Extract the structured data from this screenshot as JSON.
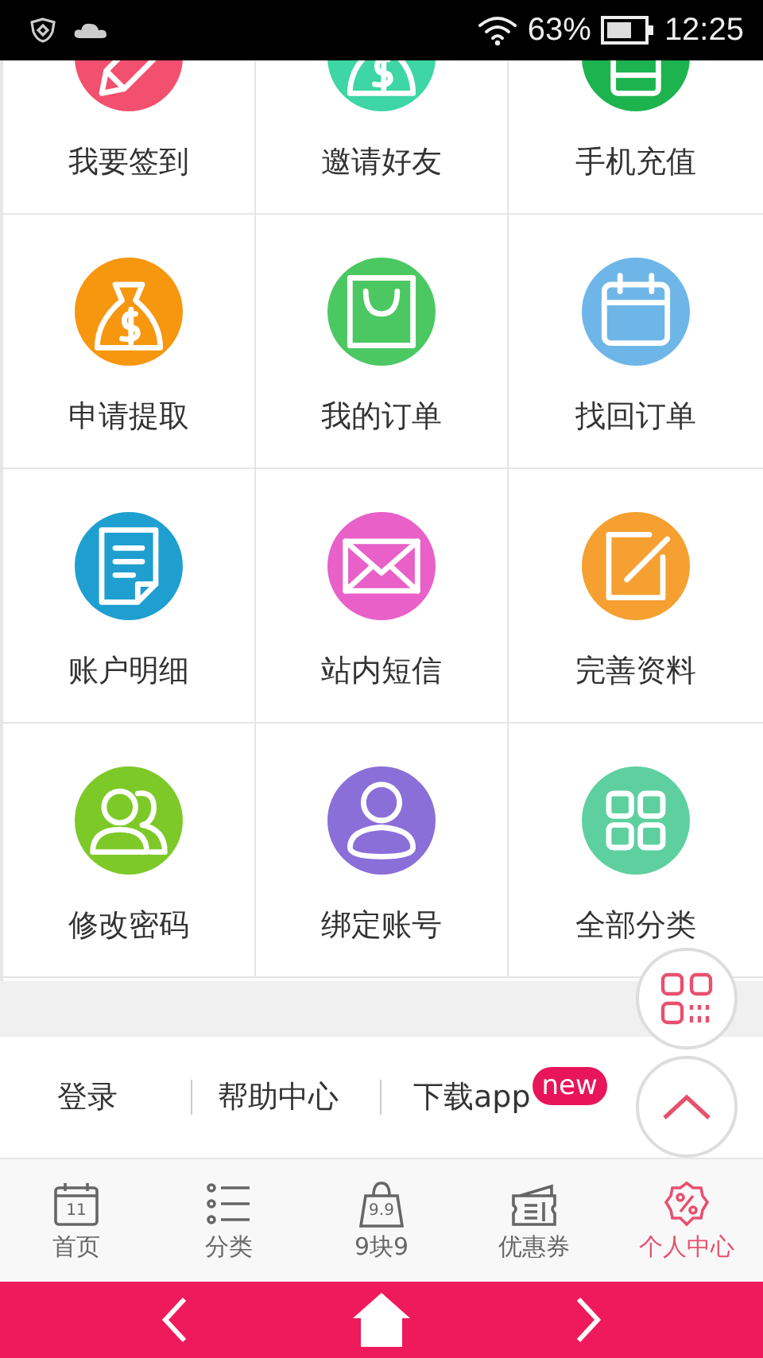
{
  "status_bar": {
    "battery": "63%",
    "time": "12:25"
  },
  "grid": [
    {
      "label": "我要签到",
      "color": "#f2506e"
    },
    {
      "label": "邀请好友",
      "color": "#3dd6a4"
    },
    {
      "label": "手机充值",
      "color": "#1db34f"
    },
    {
      "label": "申请提取",
      "color": "#f7960f"
    },
    {
      "label": "我的订单",
      "color": "#4cc862"
    },
    {
      "label": "找回订单",
      "color": "#6fb6e8"
    },
    {
      "label": "账户明细",
      "color": "#1e9fd0"
    },
    {
      "label": "站内短信",
      "color": "#e860c8"
    },
    {
      "label": "完善资料",
      "color": "#f5a030"
    },
    {
      "label": "修改密码",
      "color": "#7dc928"
    },
    {
      "label": "绑定账号",
      "color": "#8a6fd8"
    },
    {
      "label": "全部分类",
      "color": "#5ed0a0"
    }
  ],
  "footer_links": [
    {
      "label": "登录"
    },
    {
      "label": "帮助中心"
    },
    {
      "label": "下载app",
      "badge": "new"
    }
  ],
  "tabs": [
    {
      "label": "首页",
      "icon_text": "11",
      "selected": false
    },
    {
      "label": "分类",
      "selected": false
    },
    {
      "label": "9块9",
      "icon_text": "9.9",
      "selected": false
    },
    {
      "label": "优惠券",
      "selected": false
    },
    {
      "label": "个人中心",
      "selected": true
    }
  ]
}
